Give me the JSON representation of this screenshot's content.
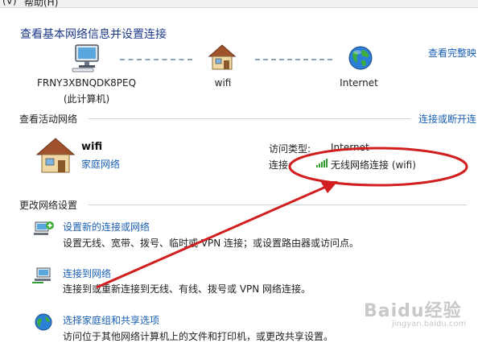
{
  "menubar": {
    "left": "(V)",
    "help": "帮助(H)"
  },
  "page_title": "查看基本网络信息并设置连接",
  "top_right_link": "查看完整映",
  "map": {
    "computer": {
      "name": "FRNY3XBNQDK8PEQ",
      "sub": "(此计算机)"
    },
    "network": {
      "name": "wifi"
    },
    "internet": {
      "name": "Internet"
    }
  },
  "active": {
    "section_label": "查看活动网络",
    "right_link": "连接或断开连",
    "network_name": "wifi",
    "network_type": "家庭网络",
    "access_type_label": "访问类型:",
    "access_type_value": "Internet",
    "connection_label": "连接:",
    "connection_value": "无线网络连接 (wifi)"
  },
  "change": {
    "section_label": "更改网络设置",
    "tasks": [
      {
        "title": "设置新的连接或网络",
        "desc": "设置无线、宽带、拨号、临时或 VPN 连接；或设置路由器或访问点。"
      },
      {
        "title": "连接到网络",
        "desc": "连接到或重新连接到无线、有线、拨号或 VPN 网络连接。"
      },
      {
        "title": "选择家庭组和共享选项",
        "desc": "访问位于其他网络计算机上的文件和打印机，或更改共享设置。"
      }
    ]
  },
  "watermark": {
    "brand": "Baidu经验",
    "url": "jingyan.baidu.com"
  },
  "colors": {
    "link": "#1a5fb4",
    "title": "#1e3a8a",
    "annotation": "#d11f1f",
    "signal": "#2f9e2f"
  }
}
